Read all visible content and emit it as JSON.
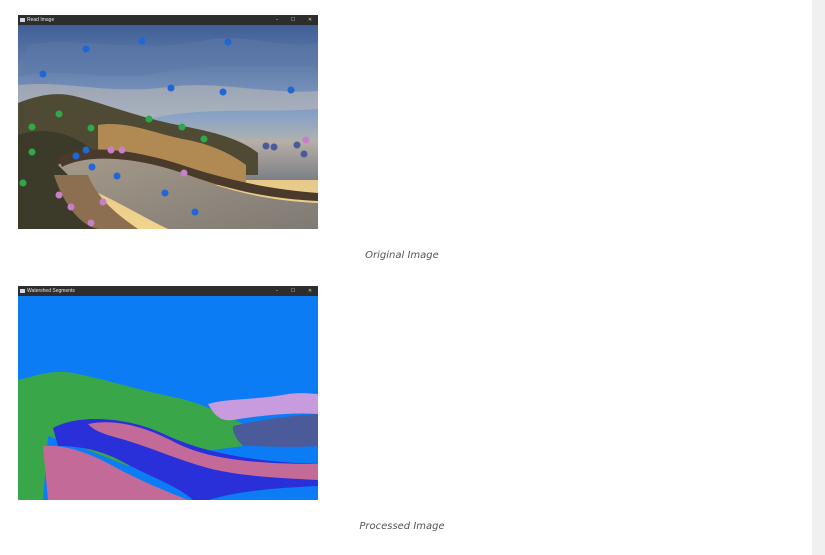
{
  "windows": [
    {
      "title": "Read Image",
      "controls": {
        "minimize": "–",
        "maximize": "☐",
        "close": "✕"
      }
    },
    {
      "title": "Watershed Segments",
      "controls": {
        "minimize": "–",
        "maximize": "☐",
        "close": "✕"
      }
    }
  ],
  "captions": {
    "original": "Original Image",
    "processed": "Processed Image"
  },
  "colors": {
    "marker_blue": "#1f66d6",
    "marker_green": "#2fa84a",
    "marker_pink": "#c77fc7",
    "segment_sky": "#0c7cf5",
    "segment_green": "#3aa64a",
    "segment_road": "#2a30d9",
    "segment_pink": "#c46a98",
    "segment_lilac": "#c79bde",
    "segment_sea": "#4b5b9a"
  },
  "icons": {
    "window_icon": "app-window-icon",
    "minimize": "minimize-icon",
    "maximize": "maximize-icon",
    "close": "close-icon"
  }
}
